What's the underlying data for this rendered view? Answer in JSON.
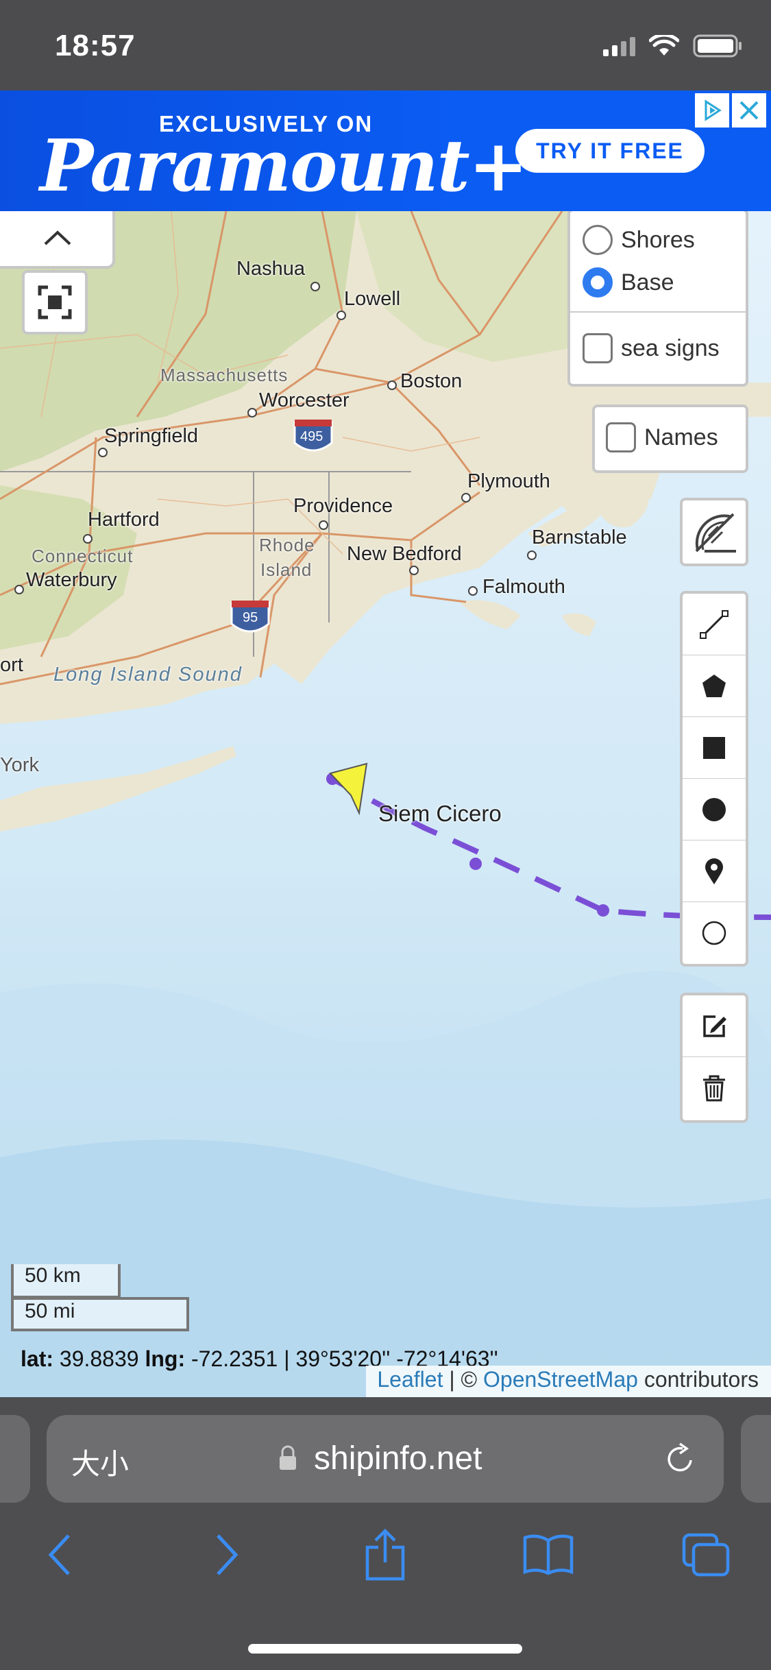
{
  "status_bar": {
    "time": "18:57",
    "icons": [
      "signal-icon",
      "wifi-icon",
      "battery-icon"
    ]
  },
  "ad": {
    "eyebrow": "EXCLUSIVELY ON",
    "brand": "Paramount+",
    "cta": "TRY IT FREE",
    "icons": [
      "adchoices-icon",
      "close-icon"
    ],
    "accent": "#0b5cf3"
  },
  "map": {
    "labels": {
      "nashua": "Nashua",
      "lowell": "Lowell",
      "massachusetts": "Massachusetts",
      "boston": "Boston",
      "worcester": "Worcester",
      "springfield": "Springfield",
      "i495": "495",
      "plymouth": "Plymouth",
      "hartford": "Hartford",
      "providence": "Providence",
      "barnstable": "Barnstable",
      "connecticut": "Connecticut",
      "rhode": "Rhode",
      "island": "Island",
      "new_bedford": "New Bedford",
      "waterbury": "Waterbury",
      "falmouth": "Falmouth",
      "i95": "95",
      "ort": "ort",
      "long_island_sound": "Long Island Sound",
      "york": "York"
    },
    "vessel": {
      "name": "Siem Cicero",
      "track_color": "#7a4fd6",
      "marker_color": "#f4f23a"
    },
    "layers": {
      "shores": "Shores",
      "base": "Base",
      "sea_signs": "sea signs",
      "names": "Names",
      "selected": "base"
    },
    "collapse_icon": "chevron-up-icon",
    "locate_icon": "locate-icon",
    "measure_icon": "ruler-protractor-icon",
    "draw_tools": [
      "polyline-icon",
      "polygon-icon",
      "rectangle-icon",
      "circle-icon",
      "marker-icon",
      "circlemarker-icon"
    ],
    "edit_tools": [
      "edit-icon",
      "trash-icon"
    ],
    "scale": {
      "km": "50 km",
      "mi": "50 mi"
    },
    "coords": {
      "lat_label": "lat:",
      "lat": "39.8839",
      "lng_label": "lng:",
      "lng": "-72.2351",
      "dms": "| 39°53'20'' -72°14'63''"
    },
    "attribution": {
      "leaflet": "Leaflet",
      "separator": " | © ",
      "osm": "OpenStreetMap",
      "suffix": " contributors"
    }
  },
  "browser": {
    "text_size": "大小",
    "domain": "shipinfo.net",
    "icons": [
      "lock-icon",
      "reload-icon",
      "back-icon",
      "forward-icon",
      "share-icon",
      "bookmarks-icon",
      "tabs-icon"
    ]
  }
}
